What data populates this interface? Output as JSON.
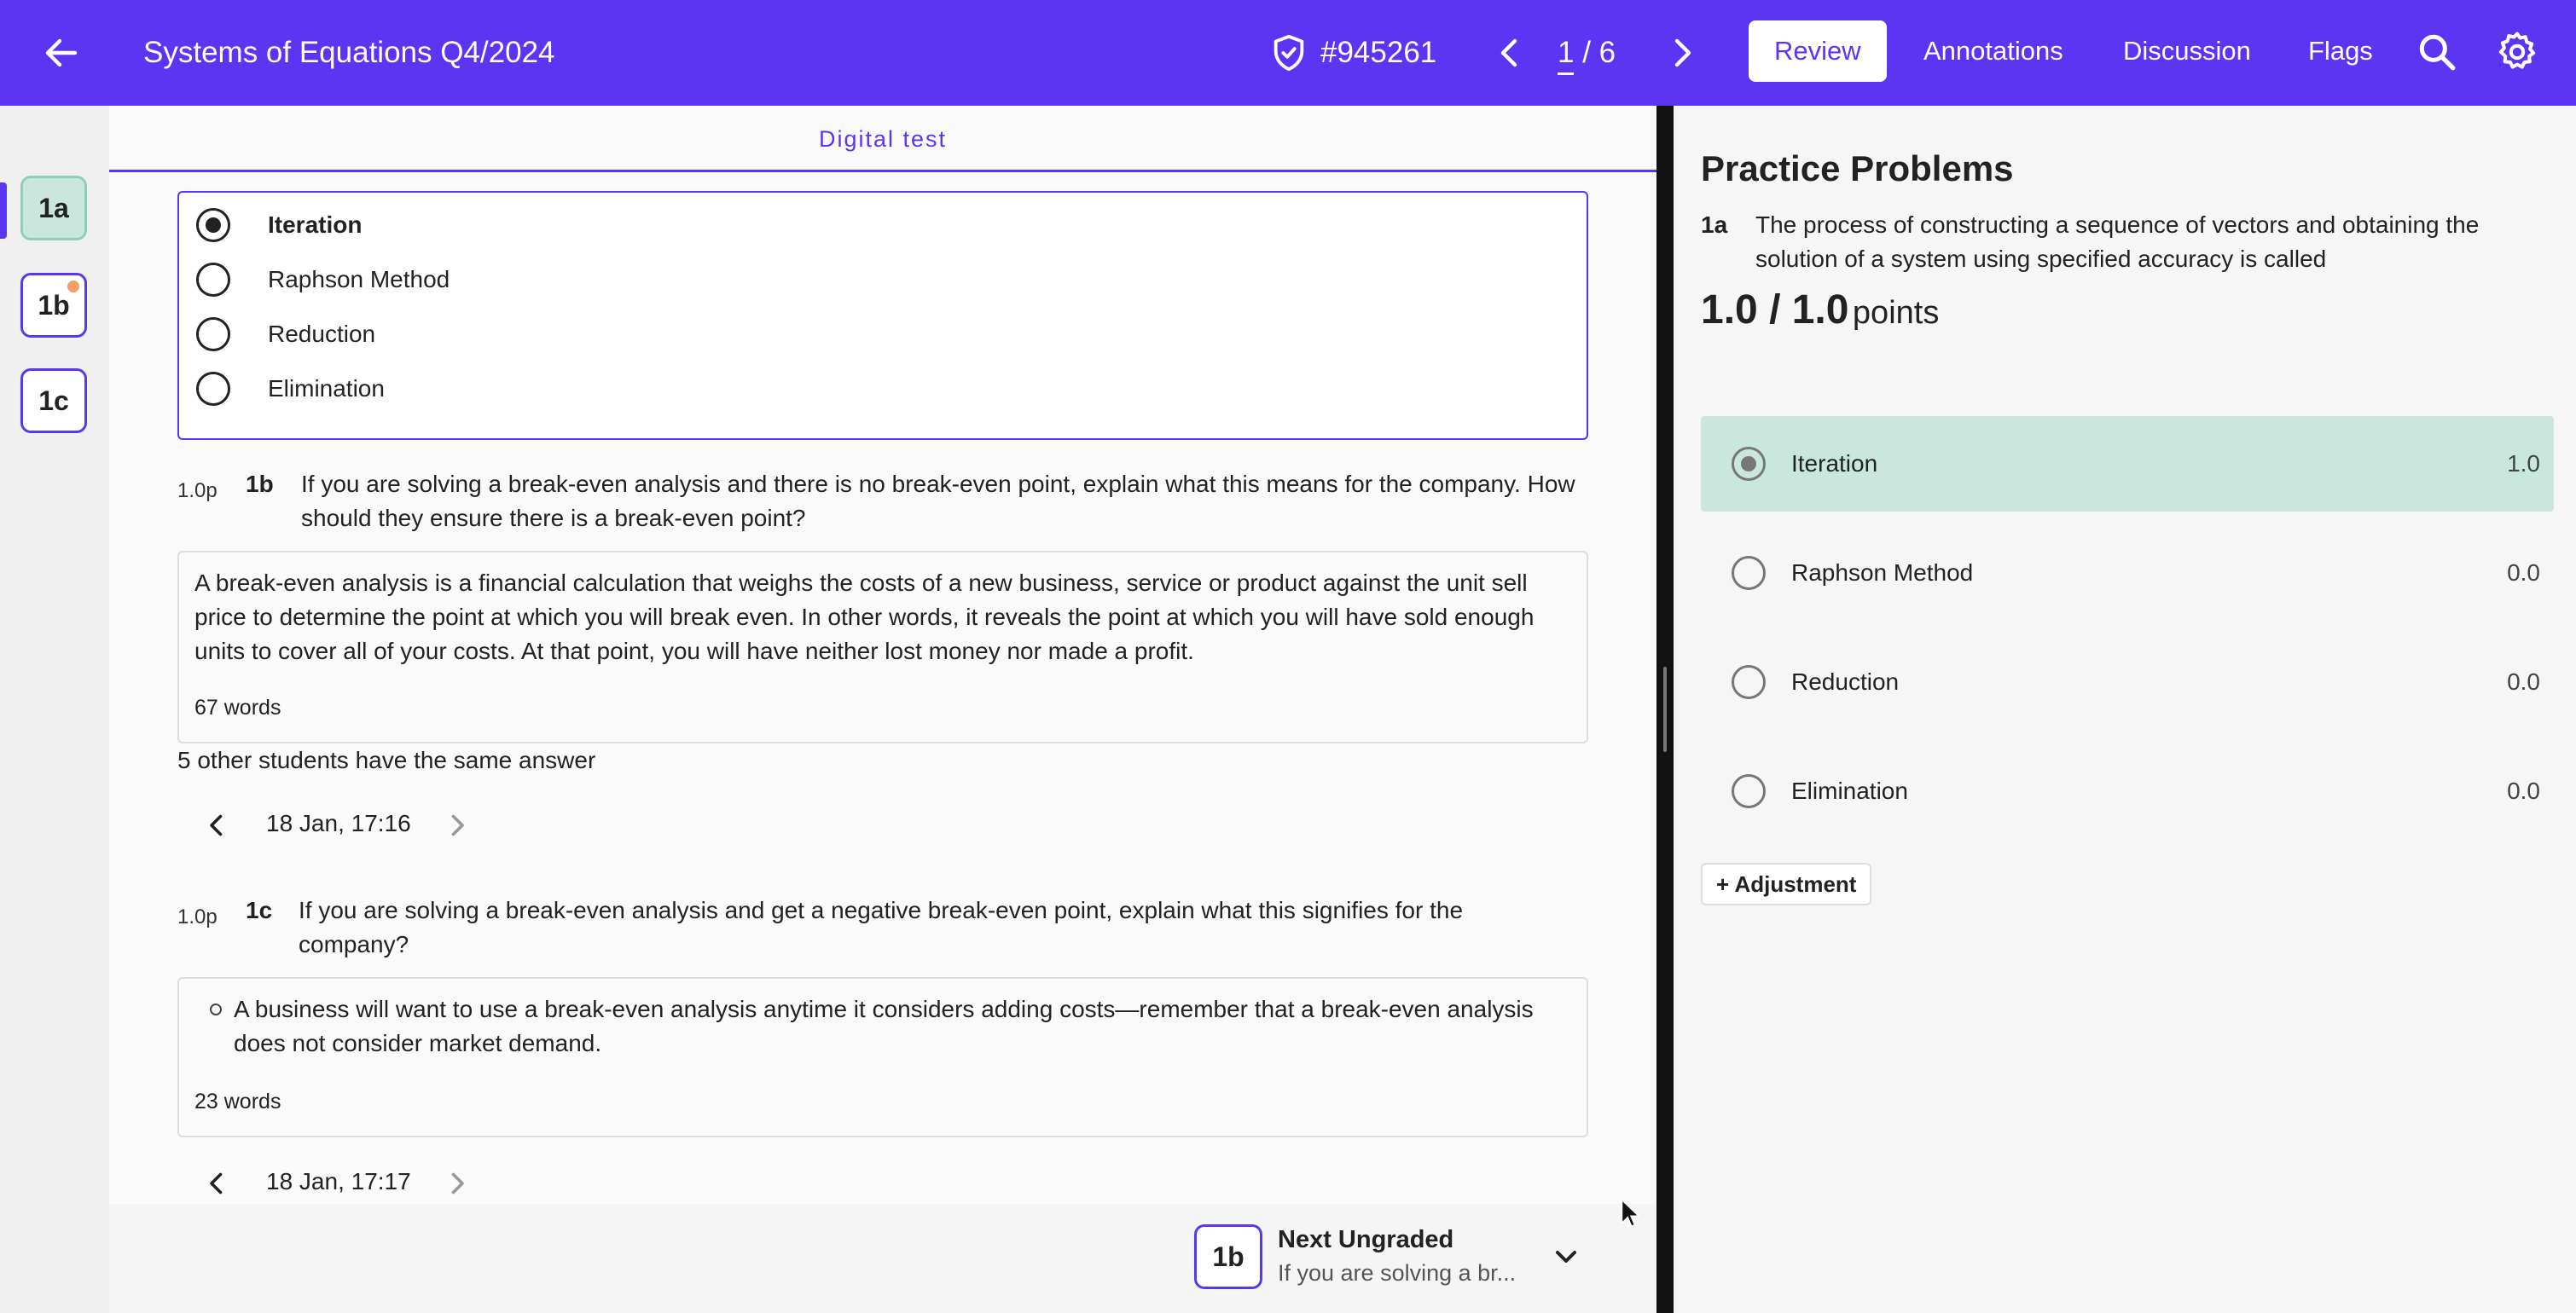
{
  "header": {
    "title": "Systems of Equations Q4/2024",
    "test_id": "#945261",
    "page_current": "1",
    "page_sep": " / ",
    "page_total": "6",
    "tabs": [
      {
        "label": "Review",
        "active": true
      },
      {
        "label": "Annotations",
        "active": false
      },
      {
        "label": "Discussion",
        "active": false
      },
      {
        "label": "Flags",
        "active": false
      }
    ],
    "accent_color": "#5b35f2"
  },
  "rail": {
    "items": [
      {
        "label": "1a",
        "status": "graded"
      },
      {
        "label": "1b",
        "status": "flagged"
      },
      {
        "label": "1c",
        "status": "ungraded"
      }
    ]
  },
  "main": {
    "section_label": "Digital test",
    "q1a_options": [
      "Iteration",
      "Raphson Method",
      "Reduction",
      "Elimination"
    ],
    "q1a_selected": "Iteration",
    "q1b": {
      "points": "1.0p",
      "number": "1b",
      "text": "If you are solving a break-even analysis and there is no break-even point, explain what this means for the company. How should they ensure there is a break-even point?",
      "answer": "A break-even analysis is a financial calculation that weighs the costs of a new business, service or product against the unit sell price to determine the point at which you will break even. In other words, it reveals the point at which you will have sold enough units to cover all of your costs. At that point, you will have neither lost money nor made a profit.",
      "word_count": "67 words",
      "same_answer": "5 other students have the same answer",
      "timestamp": "18 Jan, 17:16"
    },
    "q1c": {
      "points": "1.0p",
      "number": "1c",
      "text": "If you are solving a break-even analysis and get a negative break-even point, explain what this signifies for the company?",
      "answer": "A business will want to use a break-even analysis anytime it considers adding costs—remember that a break-even analysis does not consider market demand.",
      "word_count": "23 words",
      "timestamp": "18 Jan, 17:17"
    }
  },
  "next_ungraded": {
    "chip": "1b",
    "heading": "Next Ungraded",
    "preview": "If you are solving a br..."
  },
  "panel": {
    "heading": "Practice Problems",
    "question_number": "1a",
    "question_text": "The process of constructing a sequence of vectors and obtaining the solution of a system using specified accuracy is called",
    "score": "1.0 / 1.0",
    "score_unit": "points",
    "options": [
      {
        "label": "Iteration",
        "value": "1.0",
        "selected": true
      },
      {
        "label": "Raphson Method",
        "value": "0.0",
        "selected": false
      },
      {
        "label": "Reduction",
        "value": "0.0",
        "selected": false
      },
      {
        "label": "Elimination",
        "value": "0.0",
        "selected": false
      }
    ],
    "adjustment_label": "+ Adjustment",
    "selected_color": "#c9e7dc"
  }
}
